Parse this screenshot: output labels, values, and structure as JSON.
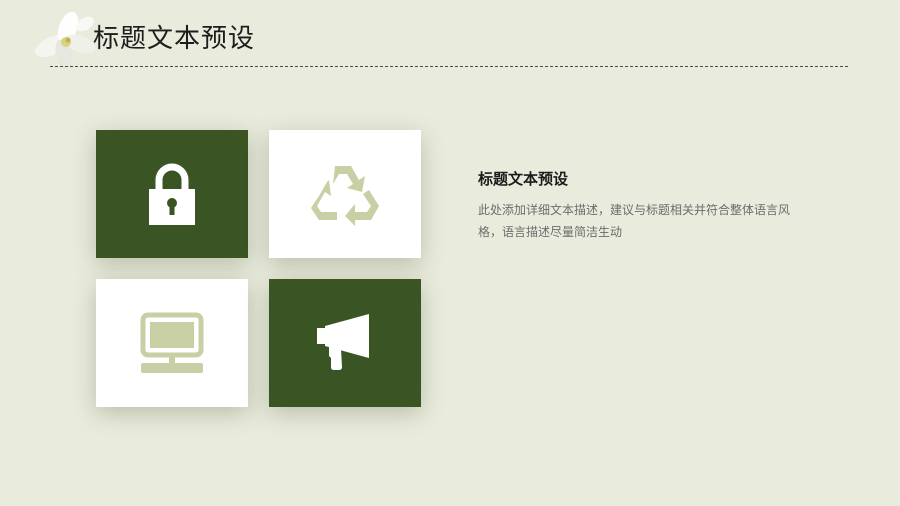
{
  "header": {
    "title": "标题文本预设"
  },
  "tiles": [
    {
      "icon": "lock-icon",
      "style": "dark"
    },
    {
      "icon": "recycle-icon",
      "style": "light"
    },
    {
      "icon": "monitor-icon",
      "style": "light"
    },
    {
      "icon": "megaphone-icon",
      "style": "dark"
    }
  ],
  "content": {
    "heading": "标题文本预设",
    "body": "此处添加详细文本描述，建议与标题相关并符合整体语言风格，语言描述尽量简洁生动"
  },
  "colors": {
    "background": "#e9ecdc",
    "dark_tile": "#3a5424",
    "light_tile": "#ffffff",
    "icon_sage": "#c9cfa4"
  }
}
